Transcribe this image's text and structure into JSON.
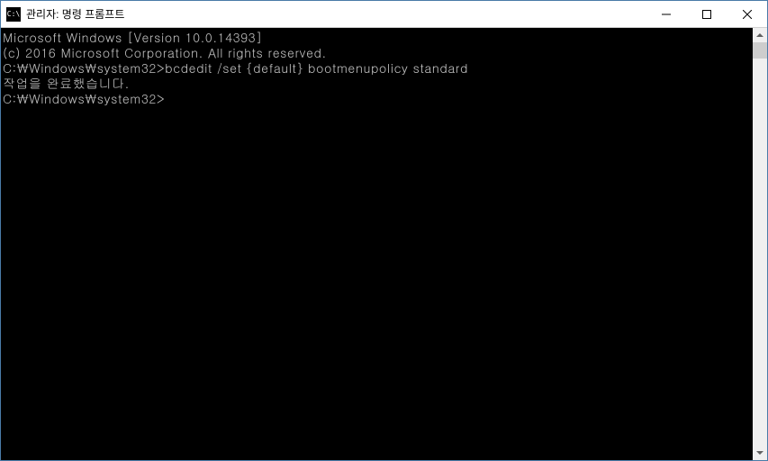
{
  "titlebar": {
    "icon_text": "C:\\",
    "title": "관리자: 명령 프롬프트"
  },
  "console": {
    "line1": "Microsoft Windows [Version 10.0.14393]",
    "line2": "(c) 2016 Microsoft Corporation. All rights reserved.",
    "line3": "",
    "line4": "C:\\Windows\\system32>bcdedit /set {default} bootmenupolicy standard",
    "line5": "작업을 완료했습니다.",
    "line6": "",
    "line7": "C:\\Windows\\system32>"
  }
}
